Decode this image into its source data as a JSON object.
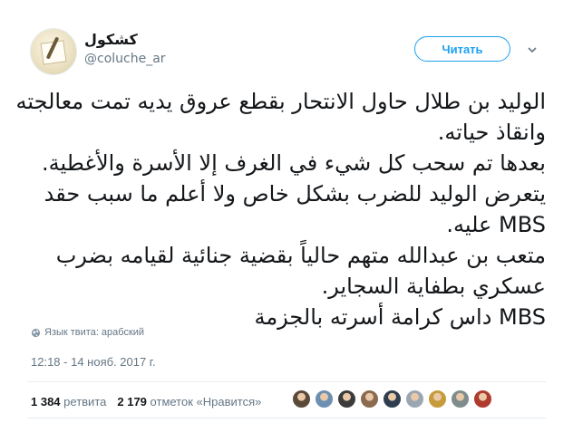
{
  "author": {
    "name": "كشكول",
    "handle": "@coluche_ar"
  },
  "follow_label": "Читать",
  "tweet_lines": [
    "الوليد بن طلال حاول الانتحار بقطع عروق يديه تمت معالجته",
    "وانقاذ حياته.",
    "بعدها تم سحب كل شيء في الغرف إلا الأسرة والأغطية.",
    "يتعرض الوليد للضرب بشكل خاص ولا أعلم ما سبب حقد",
    "MBS عليه.",
    "متعب بن عبدالله متهم حالياً بقضية جنائية لقيامه بضرب",
    "عسكري بطفاية السجاير.",
    "MBS داس كرامة أسرته بالجزمة"
  ],
  "language_note": "Язык твита: арабский",
  "timestamp": "12:18 - 14 нояб. 2017 г.",
  "stats": {
    "retweets_count": "1 384",
    "retweets_label": "ретвита",
    "likes_count": "2 179",
    "likes_label": "отметок «Нравится»"
  },
  "liker_avatar_colors": [
    "#5b4a3a",
    "#6d8fb1",
    "#3b3b3b",
    "#8a6b4f",
    "#2f3e4f",
    "#9aa7b3",
    "#c79a3b",
    "#7f8c8d",
    "#b03a2e"
  ],
  "colors": {
    "accent": "#1da1f2",
    "text": "#14171a",
    "muted": "#657786"
  }
}
